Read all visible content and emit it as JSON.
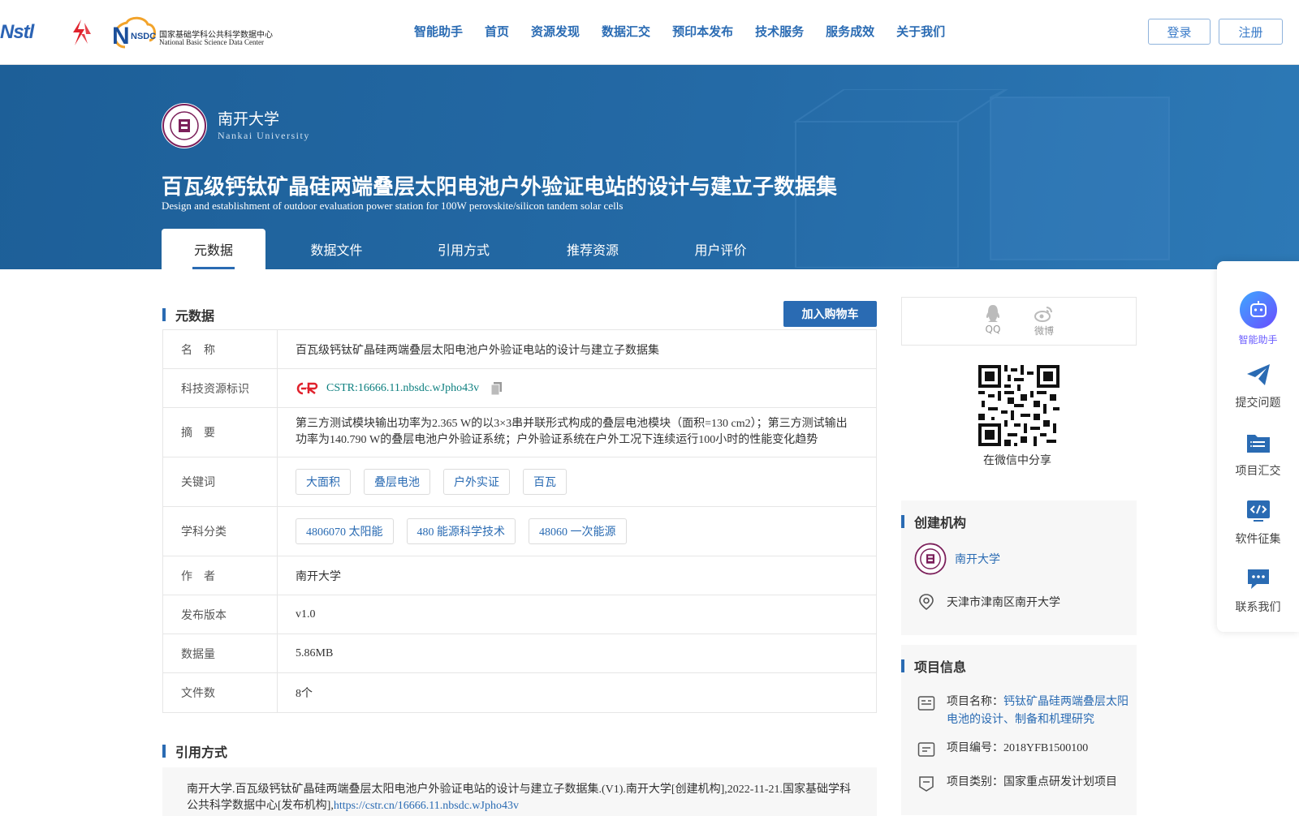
{
  "header": {
    "logo_text": "Nstl",
    "nsdc_cn": "国家基础学科公共科学数据中心",
    "nsdc_en": "National Basic Science Data Center",
    "nsdc_badge": "NSDC",
    "nav": [
      "智能助手",
      "首页",
      "资源发现",
      "数据汇交",
      "预印本发布",
      "技术服务",
      "服务成效",
      "关于我们"
    ],
    "login": "登录",
    "register": "注册"
  },
  "banner": {
    "org_cn": "南开大学",
    "org_en": "Nankai University",
    "title": "百瓦级钙钛矿晶硅两端叠层太阳电池户外验证电站的设计与建立子数据集",
    "subtitle": "Design and establishment of outdoor evaluation power station for 100W perovskite/silicon tandem solar cells",
    "tabs": [
      "元数据",
      "数据文件",
      "引用方式",
      "推荐资源",
      "用户评价"
    ]
  },
  "metadata": {
    "heading": "元数据",
    "cart_button": "加入购物车",
    "rows": {
      "name_label": "名　称",
      "name_value": "百瓦级钙钛矿晶硅两端叠层太阳电池户外验证电站的设计与建立子数据集",
      "id_label": "科技资源标识",
      "id_value": "CSTR:16666.11.nbsdc.wJpho43v",
      "abstract_label": "摘　要",
      "abstract_value": "第三方测试模块输出功率为2.365 W的以3×3串并联形式构成的叠层电池模块（面积=130 cm2）；第三方测试输出功率为140.790 W的叠层电池户外验证系统；户外验证系统在户外工况下连续运行100小时的性能变化趋势",
      "keywords_label": "关键词",
      "keywords": [
        "大面积",
        "叠层电池",
        "户外实证",
        "百瓦"
      ],
      "subject_label": "学科分类",
      "subjects": [
        "4806070 太阳能",
        "480 能源科学技术",
        "48060 一次能源"
      ],
      "author_label": "作　者",
      "author_value": "南开大学",
      "version_label": "发布版本",
      "version_value": "v1.0",
      "size_label": "数据量",
      "size_value": "5.86MB",
      "files_label": "文件数",
      "files_value": "8个"
    }
  },
  "citation": {
    "heading": "引用方式",
    "text": "南开大学.百瓦级钙钛矿晶硅两端叠层太阳电池户外验证电站的设计与建立子数据集.(V1).南开大学[创建机构],2022-11-21.国家基础学科公共科学数据中心[发布机构],",
    "link": "https://cstr.cn/16666.11.nbsdc.wJpho43v"
  },
  "share": {
    "qq": "QQ",
    "weibo": "微博",
    "wechat_caption": "在微信中分享"
  },
  "org": {
    "heading": "创建机构",
    "name": "南开大学",
    "address": "天津市津南区南开大学"
  },
  "project": {
    "heading": "项目信息",
    "name_label": "项目名称：",
    "name_value": "钙钛矿晶硅两端叠层太阳电池的设计、制备和机理研究",
    "code_label": "项目编号：",
    "code_value": "2018YFB1500100",
    "type_label": "项目类别：",
    "type_value": "国家重点研发计划项目"
  },
  "float": {
    "ai": "智能助手",
    "submit": "提交问题",
    "collect": "项目汇交",
    "software": "软件征集",
    "contact": "联系我们"
  },
  "colors": {
    "brand": "#2a6bb3",
    "banner": "#1d5f98",
    "cstr": "#0c7f7f",
    "ai": "#6a5cff"
  }
}
